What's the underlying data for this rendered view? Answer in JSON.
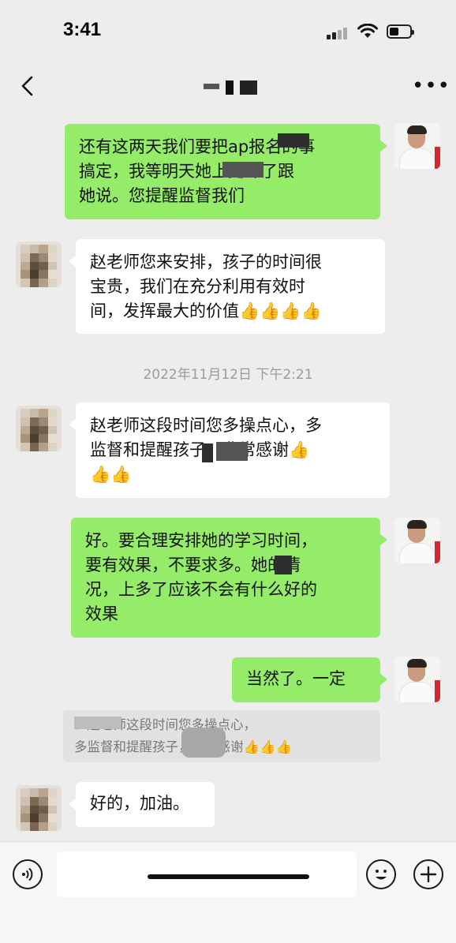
{
  "status_bar": {
    "time": "3:41"
  },
  "nav": {
    "title": ""
  },
  "messages": {
    "m1": {
      "sender": "me",
      "lines": [
        "还有这两天我们要把ap报名的事",
        "搞定，我等明天她上完课了跟",
        "她说。您提醒监督我们"
      ]
    },
    "m2": {
      "sender": "other",
      "lines": [
        "赵老师您来安排，孩子的时间很",
        "宝贵，我们在充分利用有效时",
        "间，发挥最大的价值"
      ],
      "emoji": "👍👍👍👍"
    },
    "timestamp": "2022年11月12日 下午2:21",
    "m3": {
      "sender": "other",
      "lines": [
        "赵老师这段时间您多操点心，多",
        "监督和提醒孩子。非常感谢"
      ],
      "emoji_line1": "👍",
      "emoji_line3": "👍👍"
    },
    "m4": {
      "sender": "me",
      "lines": [
        "好。要合理安排她的学习时间，",
        "要有效果，不要求多。她的情",
        "况，上多了应该不会有什么好的",
        "效果"
      ]
    },
    "m5": {
      "sender": "me",
      "text": "当然了。一定"
    },
    "quote": {
      "lines": [
        "：赵老师这段时间您多操点心，",
        "多监督和提醒孩子，非常感谢"
      ],
      "emoji": "👍👍👍"
    },
    "m6": {
      "sender": "other",
      "text": "好的，加油。"
    }
  },
  "input_bar": {
    "placeholder": ""
  },
  "colors": {
    "green_bubble": "#95ec69",
    "background": "#ededed",
    "white_bubble": "#ffffff"
  },
  "icons": [
    "back-chevron-icon",
    "more-dots-icon",
    "voice-icon",
    "emoji-icon",
    "plus-icon",
    "signal-icon",
    "wifi-icon",
    "battery-icon"
  ]
}
